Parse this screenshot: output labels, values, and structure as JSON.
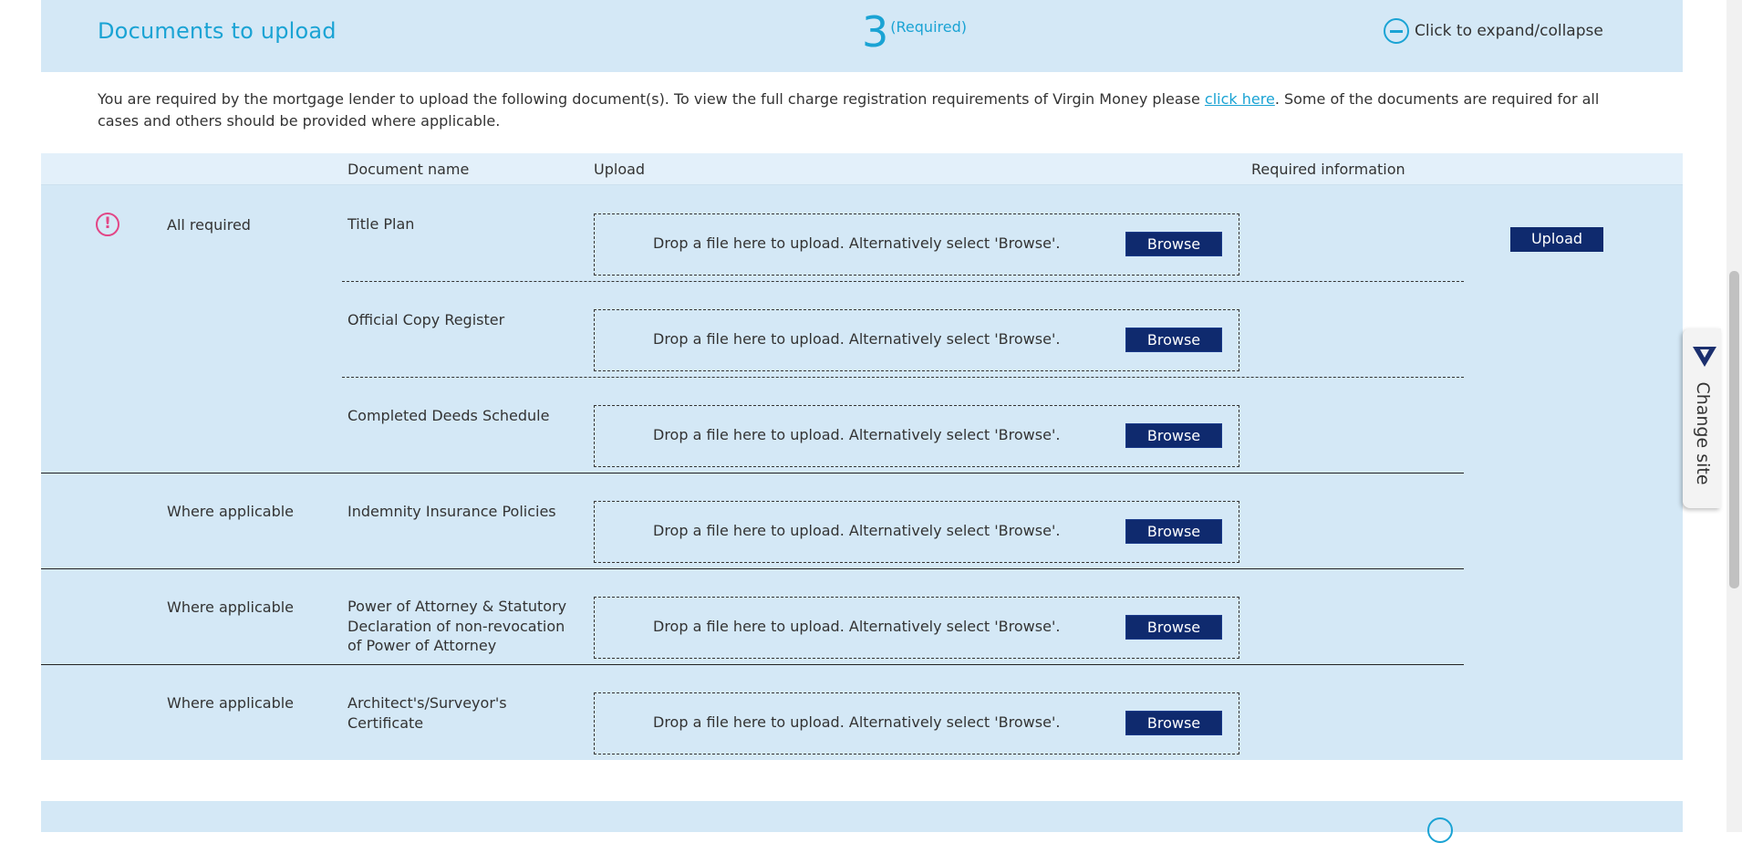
{
  "panel": {
    "title": "Documents to upload",
    "count": "3",
    "count_label": "(Required)",
    "toggle_label": "Click to expand/collapse"
  },
  "intro": {
    "before": "You are required by the mortgage lender to upload the following document(s). To view the full charge registration requirements of Virgin Money please ",
    "link": "click here",
    "after": ". Some of the documents are required for all cases and others should be provided where applicable."
  },
  "table": {
    "headers": {
      "document_name": "Document name",
      "upload": "Upload",
      "required_information": "Required information"
    },
    "rows": [
      {
        "category": "All required",
        "document": "Title Plan",
        "drop_text": "Drop a file here to upload. Alternatively select 'Browse'.",
        "browse_label": "Browse"
      },
      {
        "category": "",
        "document": "Official Copy Register",
        "drop_text": "Drop a file here to upload. Alternatively select 'Browse'.",
        "browse_label": "Browse"
      },
      {
        "category": "",
        "document": "Completed Deeds Schedule",
        "drop_text": "Drop a file here to upload. Alternatively select 'Browse'.",
        "browse_label": "Browse"
      },
      {
        "category": "Where applicable",
        "document": "Indemnity Insurance Policies",
        "drop_text": "Drop a file here to upload. Alternatively select 'Browse'.",
        "browse_label": "Browse"
      },
      {
        "category": "Where applicable",
        "document": "Power of Attorney & Statutory Declaration of non-revocation of Power of Attorney",
        "drop_text": "Drop a file here to upload. Alternatively select 'Browse'.",
        "browse_label": "Browse"
      },
      {
        "category": "Where applicable",
        "document": "Architect's/Surveyor's Certificate",
        "drop_text": "Drop a file here to upload. Alternatively select 'Browse'.",
        "browse_label": "Browse"
      }
    ],
    "upload_label": "Upload",
    "required_icon": "!"
  },
  "side_tab": {
    "label": "Change site",
    "icon": "brand-v-logo"
  },
  "colors": {
    "accent": "#1aa3d4",
    "panel_bg": "#d4e8f6",
    "button_bg": "#0f2a6e",
    "required_icon": "#e24686"
  }
}
